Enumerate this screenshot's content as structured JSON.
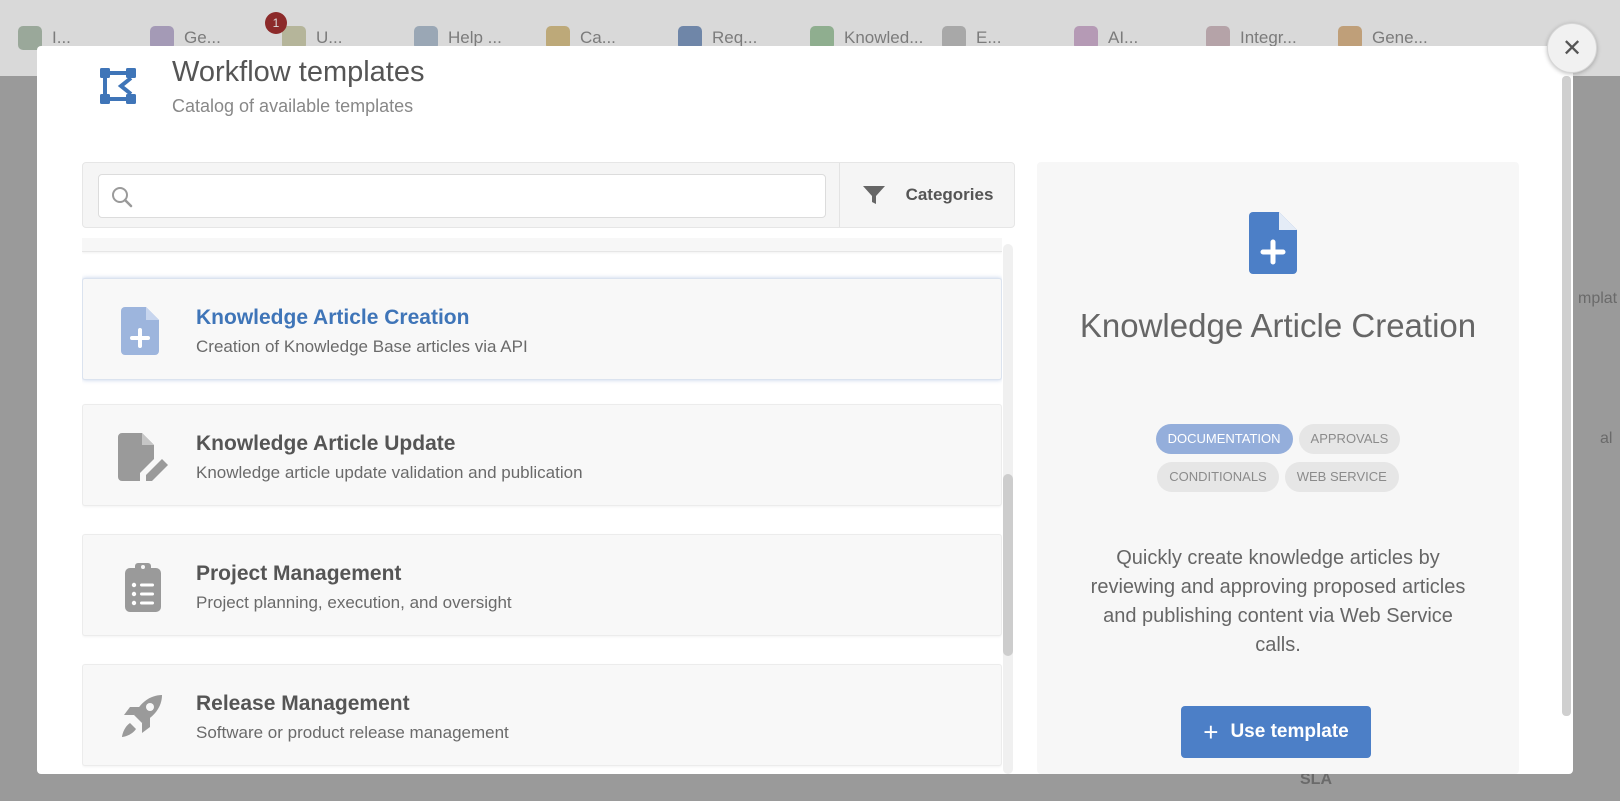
{
  "background": {
    "tabs": [
      {
        "label": "I...",
        "color": "#9aa89a"
      },
      {
        "label": "Ge...",
        "color": "#a49ab6"
      },
      {
        "label": "U...",
        "color": "#b5b59a"
      },
      {
        "label": "Help ...",
        "color": "#9aa7b5"
      },
      {
        "label": "Ca...",
        "color": "#bda979"
      },
      {
        "label": "Req...",
        "color": "#6f86a8"
      },
      {
        "label": "Knowled...",
        "color": "#8fae8f"
      },
      {
        "label": "E...",
        "color": "#a8a8a8"
      },
      {
        "label": "AI...",
        "color": "#b59ab5"
      },
      {
        "label": "Integr...",
        "color": "#b5a3a8"
      },
      {
        "label": "Gene...",
        "color": "#bf9f79"
      }
    ],
    "badge_count": "1",
    "right_text_1": "mplat",
    "right_text_2": "al",
    "bottom_text": "SLA"
  },
  "modal": {
    "title": "Workflow templates",
    "subtitle": "Catalog of available templates",
    "close_label": "✕"
  },
  "search": {
    "value": "",
    "placeholder": ""
  },
  "filter": {
    "categories_label": "Categories"
  },
  "templates": [
    {
      "title": "Knowledge Article Creation",
      "description": "Creation of Knowledge Base articles via API",
      "icon": "file-plus-icon",
      "selected": true
    },
    {
      "title": "Knowledge Article Update",
      "description": "Knowledge article update validation and publication",
      "icon": "file-edit-icon",
      "selected": false
    },
    {
      "title": "Project Management",
      "description": "Project planning, execution, and oversight",
      "icon": "clipboard-list-icon",
      "selected": false
    },
    {
      "title": "Release Management",
      "description": "Software or product release management",
      "icon": "rocket-icon",
      "selected": false
    }
  ],
  "detail": {
    "title": "Knowledge Article Creation",
    "tags": [
      {
        "label": "DOCUMENTATION",
        "active": true
      },
      {
        "label": "APPROVALS",
        "active": false
      },
      {
        "label": "CONDITIONALS",
        "active": false
      },
      {
        "label": "WEB SERVICE",
        "active": false
      }
    ],
    "description": "Quickly create knowledge articles by reviewing and approving proposed articles and publishing content via Web Service calls.",
    "use_button_label": "Use template"
  },
  "colors": {
    "accent": "#4c7fc7",
    "active_title": "#3f75b8",
    "tag_active": "#94aedb"
  }
}
